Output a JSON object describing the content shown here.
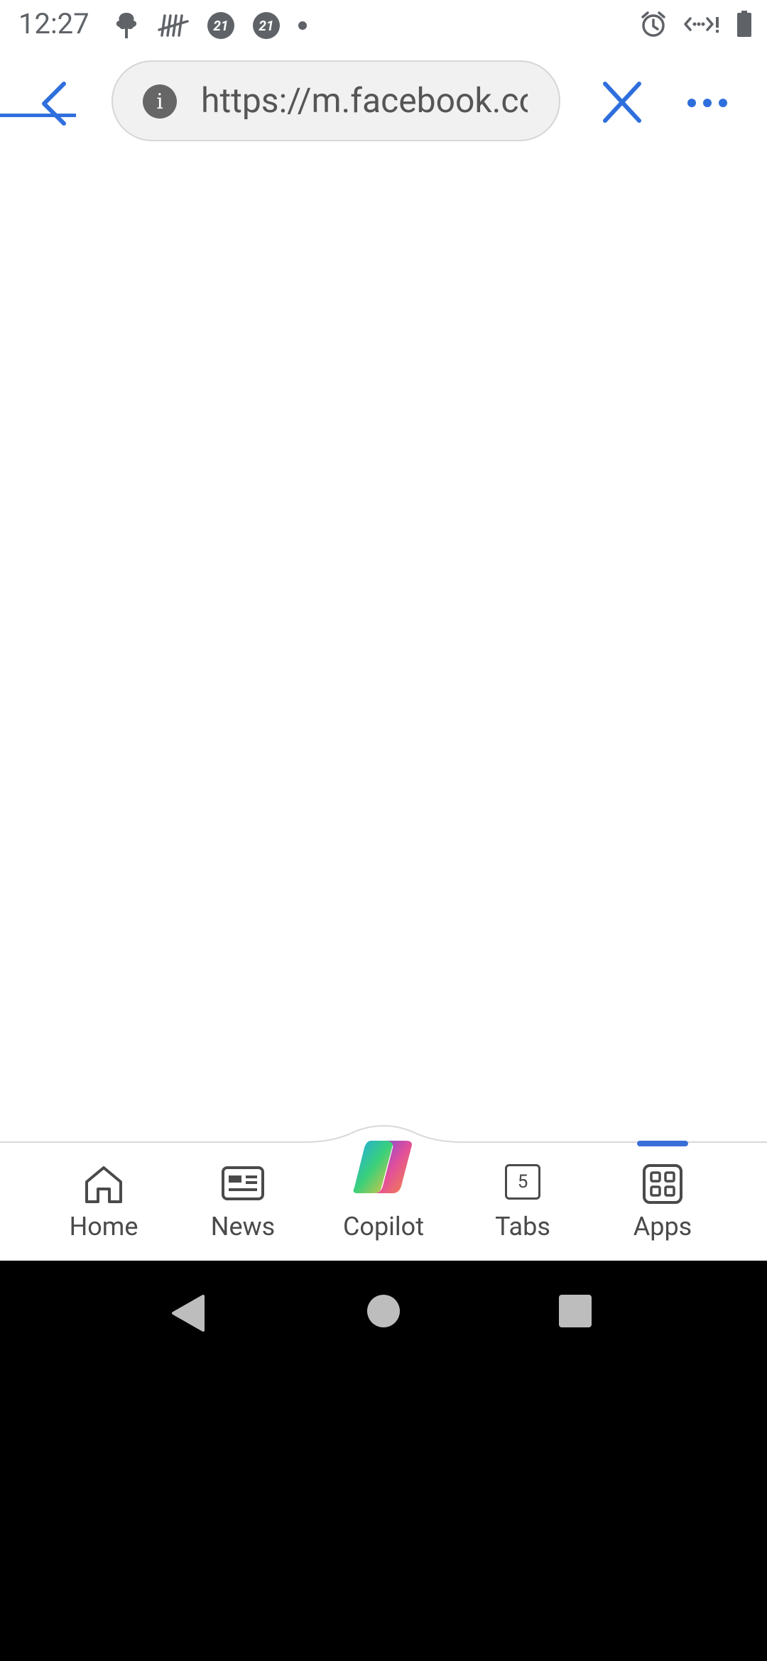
{
  "status_bar": {
    "time": "12:27",
    "badges": [
      "21",
      "21"
    ],
    "icons_left": [
      "cloud-tree-icon",
      "tally-icon",
      "badge-21-icon",
      "badge-21-icon",
      "dot-icon"
    ],
    "icons_right": [
      "alarm-icon",
      "data-saver-icon",
      "battery-icon"
    ]
  },
  "toolbar": {
    "url": "https://m.facebook.com/",
    "icons": [
      "back-arrow-icon",
      "info-icon",
      "close-icon",
      "more-icon"
    ],
    "accent_color": "#2f6fdd",
    "info_glyph": "i"
  },
  "bottom_nav": {
    "items": [
      {
        "label": "Home",
        "icon": "home-icon"
      },
      {
        "label": "News",
        "icon": "news-icon"
      },
      {
        "label": "Copilot",
        "icon": "copilot-icon"
      },
      {
        "label": "Tabs",
        "icon": "tabs-icon",
        "count": "5"
      },
      {
        "label": "Apps",
        "icon": "apps-icon",
        "selected": true
      }
    ]
  },
  "system_nav": {
    "icons": [
      "back-triangle-icon",
      "home-circle-icon",
      "recents-square-icon"
    ]
  }
}
